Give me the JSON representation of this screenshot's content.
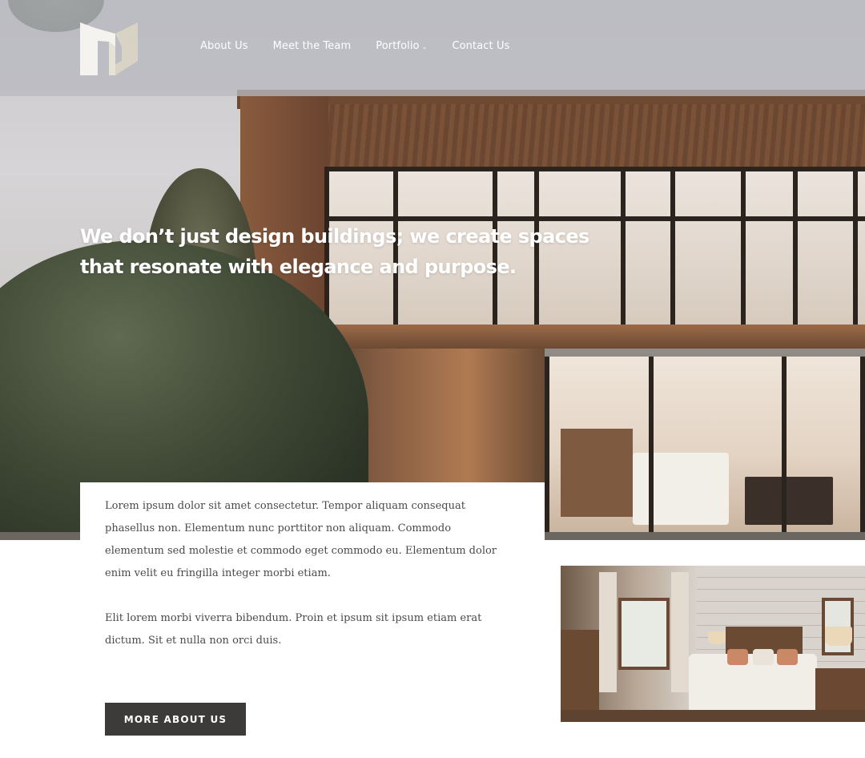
{
  "header": {
    "logo_name": "nc-monogram-logo",
    "nav": [
      {
        "label": "About Us",
        "has_dropdown": false
      },
      {
        "label": "Meet the Team",
        "has_dropdown": false
      },
      {
        "label": "Portfolio",
        "has_dropdown": true
      },
      {
        "label": "Contact Us",
        "has_dropdown": false
      }
    ],
    "dropdown_icon": "chevron-down-icon"
  },
  "hero": {
    "tagline": "We don’t just design buildings; we create spaces that resonate with elegance and purpose."
  },
  "intro": {
    "paragraph_1": "Lorem ipsum dolor sit amet consectetur. Tempor aliquam consequat phasellus non. Elementum nunc porttitor non aliquam. Commodo elementum sed molestie et commodo eget commodo eu. Elementum dolor enim velit eu fringilla integer morbi etiam.",
    "paragraph_2": "Elit lorem morbi viverra bibendum. Proin et ipsum sit ipsum etiam erat dictum. Sit et nulla non orci duis.",
    "button_label": "MORE ABOUT US"
  },
  "colors": {
    "header_overlay": "#b8b8c0",
    "button_bg": "#3d3b39",
    "body_text": "#4a4a4a",
    "logo_light": "#f4f3ef",
    "logo_shade": "#d8d3c4"
  }
}
